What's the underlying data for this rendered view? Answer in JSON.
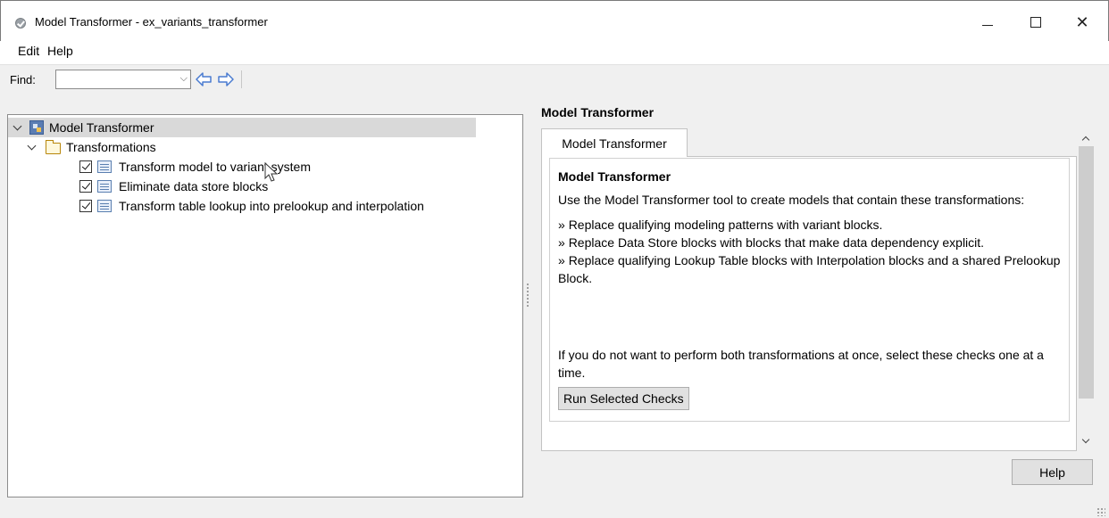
{
  "window": {
    "title": "Model Transformer - ex_variants_transformer",
    "minimize_glyph": "—",
    "close_glyph": "✕"
  },
  "menu": {
    "edit": "Edit",
    "help": "Help"
  },
  "toolbar": {
    "find_label": "Find:",
    "find_value": "",
    "find_placeholder": "",
    "combo_arrow": "⌵"
  },
  "tree": {
    "root_label": "Model Transformer",
    "folder_label": "Transformations",
    "checks": [
      {
        "label": "Transform model to variant system",
        "checked": true
      },
      {
        "label": "Eliminate data store blocks",
        "checked": true
      },
      {
        "label": "Transform table lookup into prelookup and interpolation",
        "checked": true
      }
    ]
  },
  "right_panel": {
    "title": "Model Transformer",
    "tab_label": "Model Transformer",
    "content_title": "Model Transformer",
    "intro": "Use the Model Transformer tool to create models that contain these transformations:",
    "bullets": [
      "Replace qualifying modeling patterns with variant blocks.",
      "Replace Data Store blocks with blocks that make data dependency explicit.",
      "Replace qualifying Lookup Table blocks with Interpolation blocks and a shared Prelookup Block."
    ],
    "note": "If you do not want to perform both transformations at once, select these checks one at a time.",
    "run_button": "Run Selected Checks"
  },
  "help_button": "Help",
  "colors": {
    "selection": "#d9d9d9",
    "nav_arrow": "#4a7bd0",
    "panel_bg": "#f0f0f0"
  }
}
